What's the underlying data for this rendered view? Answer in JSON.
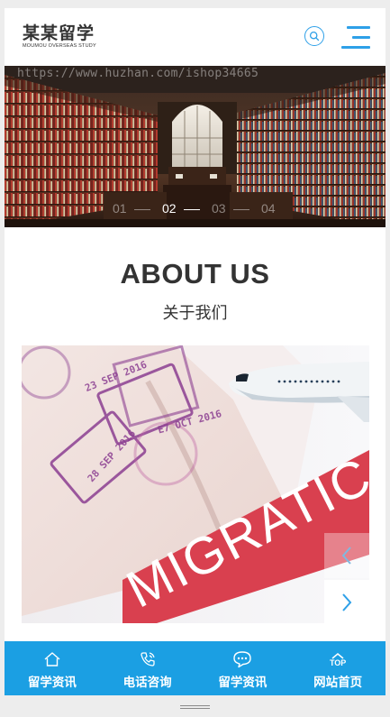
{
  "header": {
    "logo_main": "某某留学",
    "logo_sub": "MOUMOU OVERSEAS STUDY",
    "search_icon": "search-icon",
    "menu_icon": "hamburger-menu-icon",
    "accent_color": "#2ea0e8"
  },
  "banner": {
    "watermark": "https://www.huzhan.com/ishop34665",
    "slides": [
      "01",
      "02",
      "03",
      "04"
    ],
    "active_slide": "02"
  },
  "about": {
    "title": "ABOUT US",
    "subtitle": "关于我们",
    "image_text": "MIGRATIC",
    "stamp_texts": [
      "23 SEP 2016",
      "28 SEP 2016",
      "E7 OCT 2016"
    ]
  },
  "slider_controls": {
    "prev_icon": "chevron-left-icon",
    "next_icon": "chevron-right-icon"
  },
  "bottom_nav": {
    "color": "#1b9fe3",
    "items": [
      {
        "label": "留学资讯",
        "icon": "home-icon"
      },
      {
        "label": "电话咨询",
        "icon": "phone-icon"
      },
      {
        "label": "留学资讯",
        "icon": "chat-icon"
      },
      {
        "label": "网站首页",
        "icon": "top-arrow-icon",
        "icon_text": "TOP"
      }
    ]
  }
}
